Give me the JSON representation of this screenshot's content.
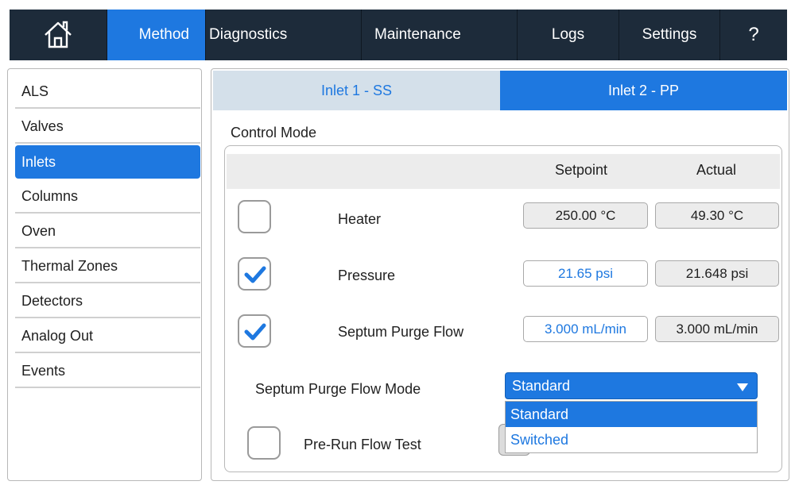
{
  "nav": {
    "home_icon": "home-icon",
    "method": "Method",
    "diagnostics": "Diagnostics",
    "maintenance": "Maintenance",
    "logs": "Logs",
    "settings": "Settings",
    "help": "?"
  },
  "sidebar": {
    "items": [
      {
        "label": "ALS"
      },
      {
        "label": "Valves"
      },
      {
        "label": "Inlets"
      },
      {
        "label": "Columns"
      },
      {
        "label": "Oven"
      },
      {
        "label": "Thermal Zones"
      },
      {
        "label": "Detectors"
      },
      {
        "label": "Analog Out"
      },
      {
        "label": "Events"
      }
    ],
    "active_index": 2
  },
  "tabs": [
    {
      "label": "Inlet 1 - SS"
    },
    {
      "label": "Inlet 2 - PP"
    }
  ],
  "control": {
    "title": "Control Mode",
    "header_setpoint": "Setpoint",
    "header_actual": "Actual",
    "rows": [
      {
        "label": "Heater",
        "checked": false,
        "setpoint": "250.00 °C",
        "actual": "49.30 °C"
      },
      {
        "label": "Pressure",
        "checked": true,
        "setpoint": "21.65 psi",
        "actual": "21.648 psi"
      },
      {
        "label": "Septum Purge Flow",
        "checked": true,
        "setpoint": "3.000 mL/min",
        "actual": "3.000 mL/min"
      }
    ],
    "purge_mode_label": "Septum Purge Flow Mode",
    "purge_mode_value": "Standard",
    "purge_mode_options": [
      "Standard",
      "Switched"
    ],
    "prerun_label": "Pre-Run Flow Test",
    "prerun_checked": false
  },
  "colors": {
    "nav_bg": "#1d2b3a",
    "accent": "#1e78e0",
    "tab_inactive": "#d4e0ea"
  }
}
